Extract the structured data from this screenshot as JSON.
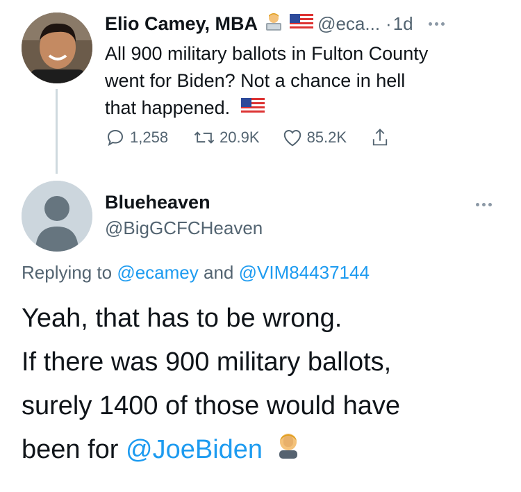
{
  "parent_tweet": {
    "author_name": "Elio Camey, MBA",
    "handle": "@eca...",
    "separator": "·",
    "time": "1d",
    "text_lines": [
      "All 900 military ballots in Fulton County",
      "went for Biden? Not a chance in hell",
      "that happened."
    ],
    "name_icons": [
      "man-technologist-emoji",
      "us-flag-emoji"
    ],
    "trailing_icon": "us-flag-emoji",
    "replies": "1,258",
    "retweets": "20.9K",
    "likes": "85.2K"
  },
  "reply_tweet": {
    "author_name": "Blueheaven",
    "handle": "@BigGCFCHeaven",
    "replying_prefix": "Replying to",
    "replying_user1": "@ecamey",
    "replying_and": "and",
    "replying_user2": "@VIM84437144",
    "text_lines": [
      "Yeah, that has to be wrong.",
      "If there was 900 military ballots,",
      "surely 1400 of those would have"
    ],
    "last_line_prefix": "been for",
    "mention": "@JoeBiden",
    "trailing_icon": "face-palm-emoji"
  },
  "colors": {
    "text": "#0f1419",
    "secondary": "#536471",
    "link": "#1d9bf0",
    "thread_line": "#cfd9de"
  }
}
